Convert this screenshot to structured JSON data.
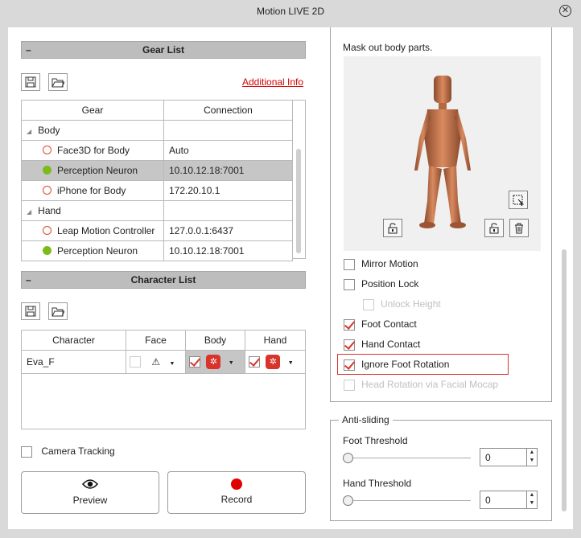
{
  "window": {
    "title": "Motion LIVE 2D",
    "close_icon": "close-circle-icon"
  },
  "gear_list": {
    "header": "Gear List",
    "collapse_glyph": "–",
    "save_icon": "save-icon",
    "open_icon": "folder-open-icon",
    "additional_info": "Additional Info",
    "columns": [
      "Gear",
      "Connection"
    ],
    "groups": [
      {
        "name": "Body",
        "items": [
          {
            "name": "Face3D for Body",
            "connection": "Auto",
            "connected": false,
            "selected": false
          },
          {
            "name": "Perception Neuron",
            "connection": "10.10.12.18:7001",
            "connected": true,
            "selected": true
          },
          {
            "name": "iPhone for Body",
            "connection": "172.20.10.1",
            "connected": false,
            "selected": false
          }
        ]
      },
      {
        "name": "Hand",
        "items": [
          {
            "name": "Leap Motion Controller",
            "connection": "127.0.0.1:6437",
            "connected": false,
            "selected": false
          },
          {
            "name": "Perception Neuron",
            "connection": "10.10.12.18:7001",
            "connected": true,
            "selected": false
          }
        ]
      }
    ]
  },
  "character_list": {
    "header": "Character List",
    "collapse_glyph": "–",
    "columns": [
      "Character",
      "Face",
      "Body",
      "Hand"
    ],
    "rows": [
      {
        "character": "Eva_F"
      }
    ],
    "dropdown_glyph": "▼"
  },
  "camera_tracking": {
    "label": "Camera Tracking",
    "checked": false
  },
  "buttons": {
    "preview": "Preview",
    "record": "Record"
  },
  "mask": {
    "title": "Mask out body parts.",
    "options": [
      {
        "label": "Mirror Motion",
        "checked": false,
        "disabled": false
      },
      {
        "label": "Position Lock",
        "checked": false,
        "disabled": false
      },
      {
        "label": "Unlock Height",
        "checked": false,
        "disabled": true
      },
      {
        "label": "Foot Contact",
        "checked": true,
        "disabled": false
      },
      {
        "label": "Hand Contact",
        "checked": true,
        "disabled": false
      },
      {
        "label": "Ignore Foot Rotation",
        "checked": true,
        "disabled": false
      },
      {
        "label": "Head Rotation via Facial Mocap",
        "checked": false,
        "disabled": true
      }
    ]
  },
  "anti_sliding": {
    "title": "Anti-sliding",
    "foot_threshold": {
      "label": "Foot Threshold",
      "value": "0"
    },
    "hand_threshold": {
      "label": "Hand Threshold",
      "value": "0"
    }
  },
  "colors": {
    "accent_red": "#d9342b",
    "connected_green": "#7dbb1d",
    "link_red": "#d40000"
  }
}
